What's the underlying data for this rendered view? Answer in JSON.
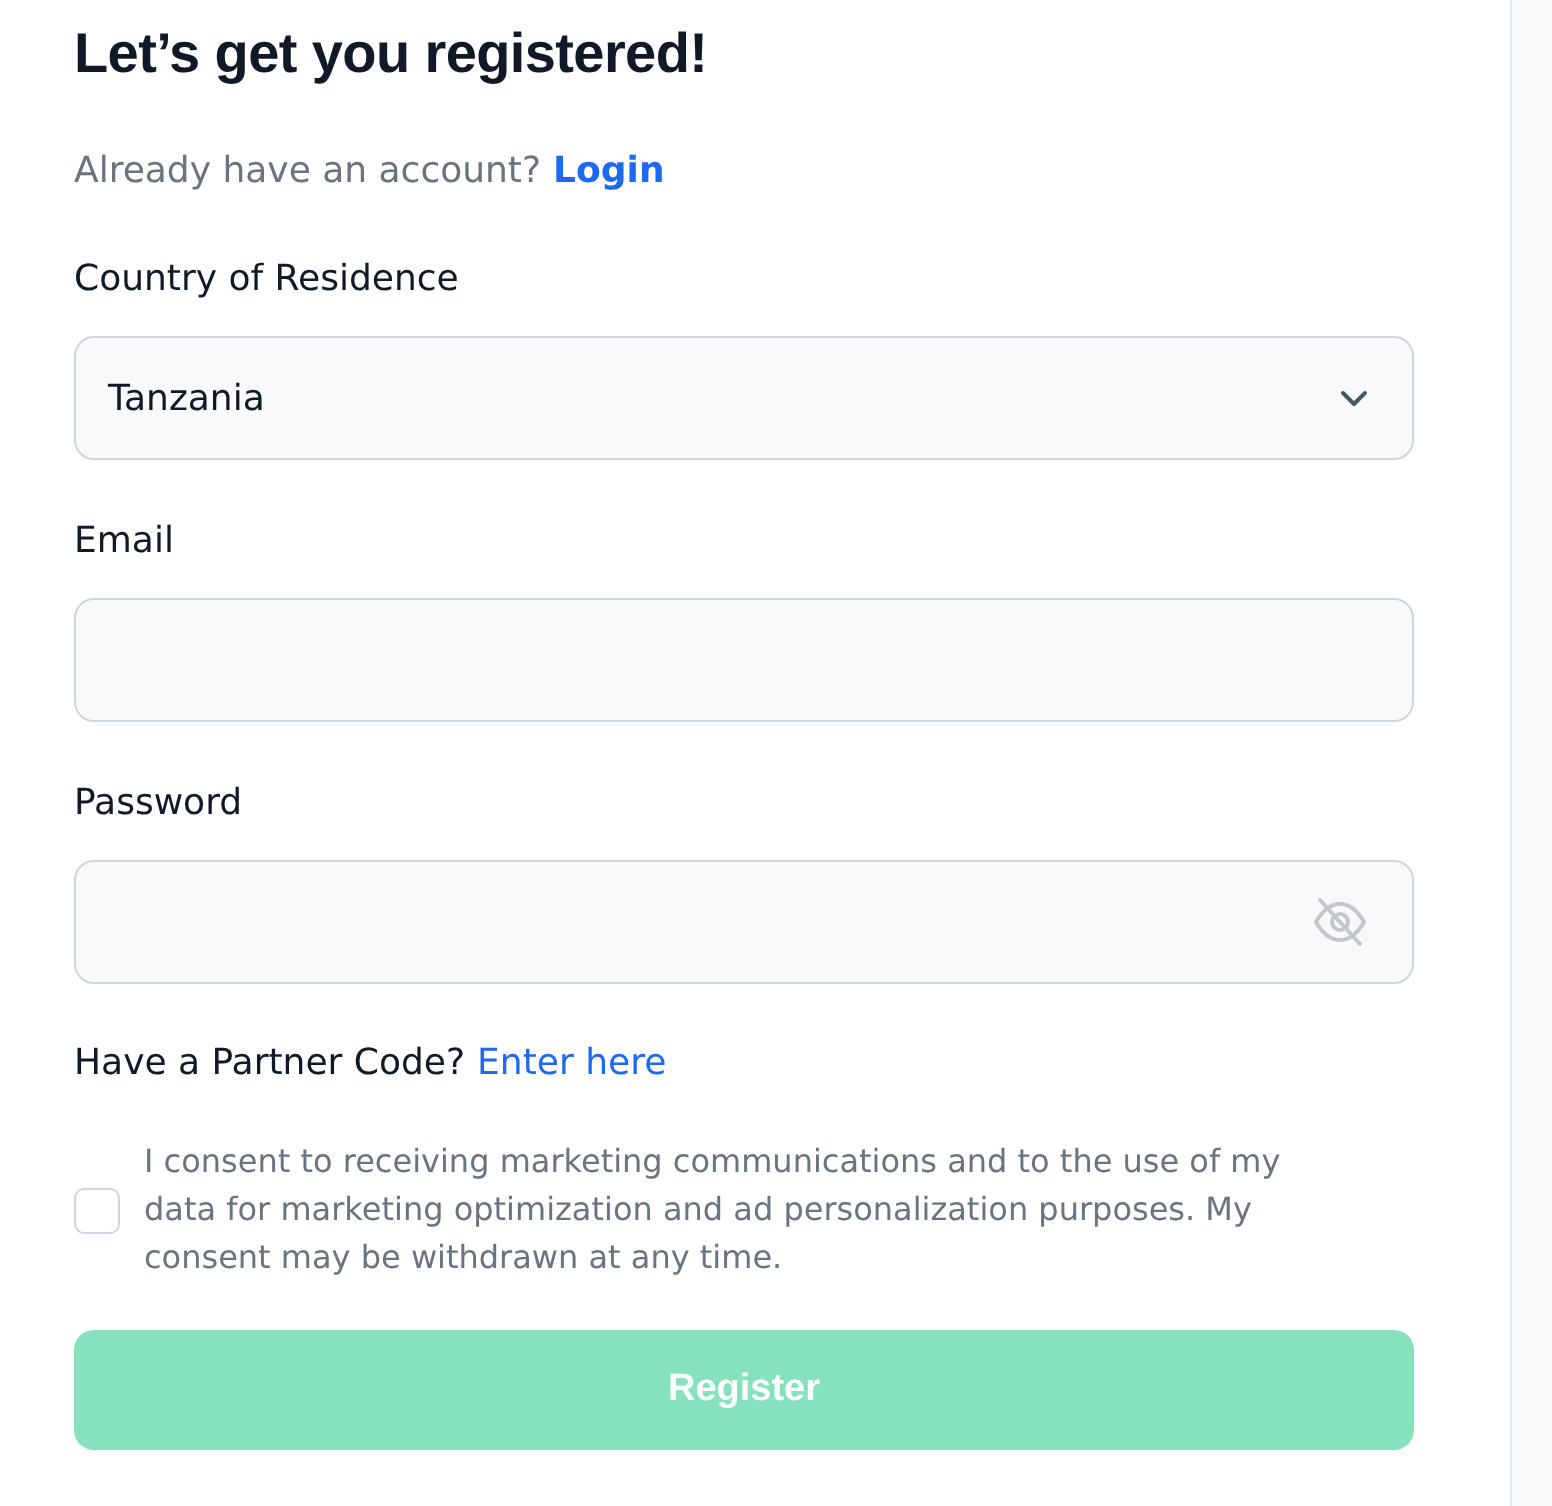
{
  "heading": "Let’s get you registered!",
  "login_prompt": {
    "text": "Already have an account?",
    "link": "Login"
  },
  "fields": [
    {
      "kind": "select",
      "label": "Country of Residence",
      "value": "Tanzania"
    },
    {
      "kind": "text",
      "label": "Email"
    },
    {
      "kind": "password",
      "label": "Password"
    }
  ],
  "partner_prompt": {
    "text": "Have a Partner Code?",
    "link": "Enter here"
  },
  "consent": {
    "checked": false,
    "text": "I consent to receiving marketing communications and to the use of my data for marketing optimization and ad personalization purposes. My consent may be withdrawn at any time."
  },
  "register_button": {
    "label": "Register",
    "disabled": true
  }
}
